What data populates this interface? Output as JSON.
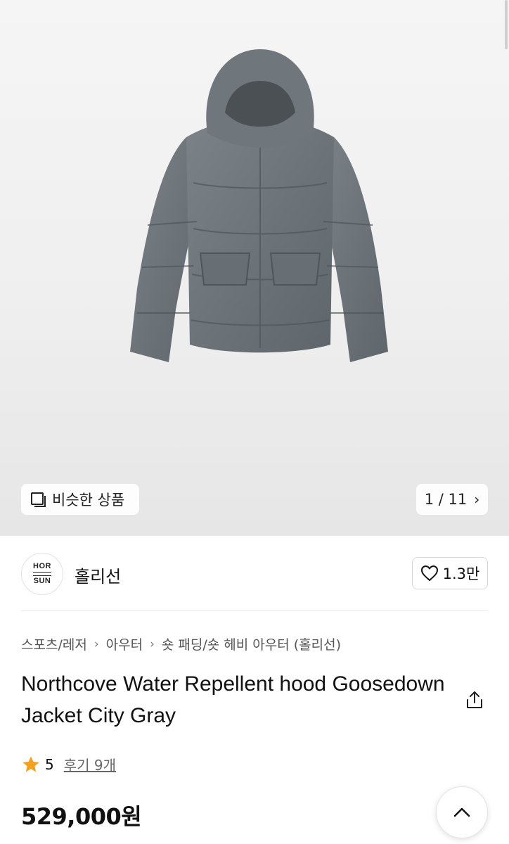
{
  "gallery": {
    "similar_label": "비슷한 상품",
    "counter": "1 / 11"
  },
  "brand": {
    "logo_line1": "HOR",
    "logo_line2": "SUN",
    "name": "홀리선",
    "like_count": "1.3만"
  },
  "breadcrumb": [
    "스포츠/레저",
    "아우터",
    "숏 패딩/숏 헤비 아우터 (홀리선)"
  ],
  "product": {
    "title": "Northcove Water Repellent hood Goosedown Jacket City Gray",
    "rating": "5",
    "review_label": "후기 9개",
    "price": "529,000원"
  },
  "colors": {
    "jacket": "#6b7278",
    "star": "#f5a11c"
  },
  "icons": [
    "copy-icon",
    "chevron-right-icon",
    "heart-icon",
    "share-icon",
    "star-icon",
    "chevron-up-icon"
  ]
}
